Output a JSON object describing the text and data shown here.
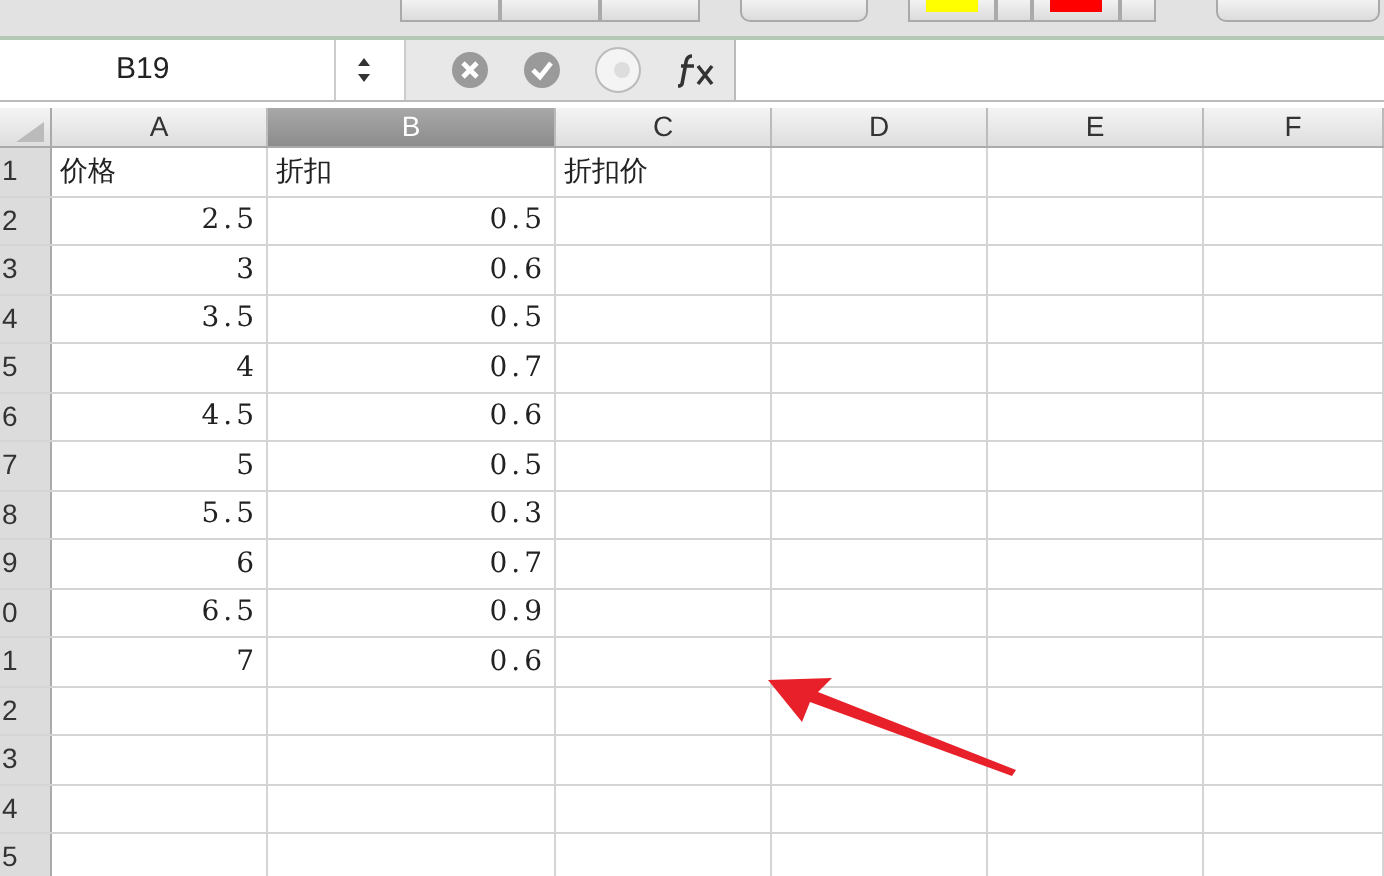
{
  "formula_bar": {
    "name_box": "B19"
  },
  "columns": [
    {
      "label": "A",
      "selected": false
    },
    {
      "label": "B",
      "selected": true
    },
    {
      "label": "C",
      "selected": false
    },
    {
      "label": "D",
      "selected": false
    },
    {
      "label": "E",
      "selected": false
    },
    {
      "label": "F",
      "selected": false
    }
  ],
  "rows": [
    {
      "header": "1",
      "cells": [
        {
          "text": "价格",
          "kind": "text"
        },
        {
          "text": "折扣",
          "kind": "text"
        },
        {
          "text": "折扣价",
          "kind": "text"
        }
      ]
    },
    {
      "header": "2",
      "cells": [
        {
          "text": "2.5",
          "kind": "number"
        },
        {
          "text": "0.5",
          "kind": "number"
        }
      ]
    },
    {
      "header": "3",
      "cells": [
        {
          "text": "3",
          "kind": "number"
        },
        {
          "text": "0.6",
          "kind": "number"
        }
      ]
    },
    {
      "header": "4",
      "cells": [
        {
          "text": "3.5",
          "kind": "number"
        },
        {
          "text": "0.5",
          "kind": "number"
        }
      ]
    },
    {
      "header": "5",
      "cells": [
        {
          "text": "4",
          "kind": "number"
        },
        {
          "text": "0.7",
          "kind": "number"
        }
      ]
    },
    {
      "header": "6",
      "cells": [
        {
          "text": "4.5",
          "kind": "number"
        },
        {
          "text": "0.6",
          "kind": "number"
        }
      ]
    },
    {
      "header": "7",
      "cells": [
        {
          "text": "5",
          "kind": "number"
        },
        {
          "text": "0.5",
          "kind": "number"
        }
      ]
    },
    {
      "header": "8",
      "cells": [
        {
          "text": "5.5",
          "kind": "number"
        },
        {
          "text": "0.3",
          "kind": "number"
        }
      ]
    },
    {
      "header": "9",
      "cells": [
        {
          "text": "6",
          "kind": "number"
        },
        {
          "text": "0.7",
          "kind": "number"
        }
      ]
    },
    {
      "header": "0",
      "cells": [
        {
          "text": "6.5",
          "kind": "number"
        },
        {
          "text": "0.9",
          "kind": "number"
        }
      ]
    },
    {
      "header": "1",
      "cells": [
        {
          "text": "7",
          "kind": "number"
        },
        {
          "text": "0.6",
          "kind": "number"
        }
      ]
    },
    {
      "header": "2",
      "cells": []
    },
    {
      "header": "3",
      "cells": []
    },
    {
      "header": "4",
      "cells": []
    },
    {
      "header": "5",
      "cells": []
    }
  ]
}
